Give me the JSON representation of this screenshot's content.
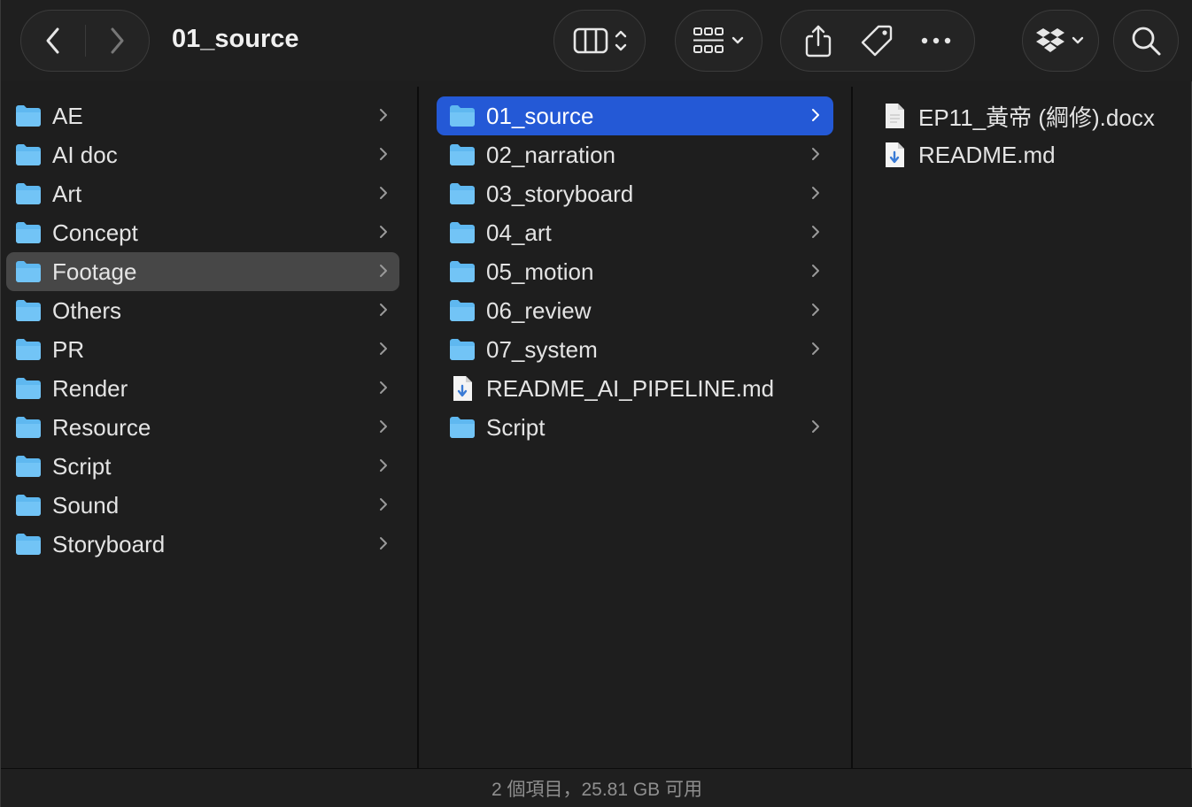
{
  "window": {
    "title": "01_source"
  },
  "toolbar": {
    "back_icon": "chevron-left-icon",
    "forward_icon": "chevron-right-icon",
    "view_icon": "columns-view-icon",
    "group_icon": "grid-group-icon",
    "share_icon": "share-icon",
    "tag_icon": "tag-icon",
    "more_icon": "ellipsis-icon",
    "dropbox_icon": "dropbox-icon",
    "search_icon": "search-icon"
  },
  "column1": {
    "items": [
      {
        "label": "AE",
        "type": "folder",
        "has_children": true
      },
      {
        "label": "AI doc",
        "type": "folder",
        "has_children": true
      },
      {
        "label": "Art",
        "type": "folder",
        "has_children": true
      },
      {
        "label": "Concept",
        "type": "folder",
        "has_children": true
      },
      {
        "label": "Footage",
        "type": "folder",
        "has_children": true,
        "selected": true
      },
      {
        "label": "Others",
        "type": "folder",
        "has_children": true
      },
      {
        "label": "PR",
        "type": "folder",
        "has_children": true
      },
      {
        "label": "Render",
        "type": "folder",
        "has_children": true
      },
      {
        "label": "Resource",
        "type": "folder",
        "has_children": true
      },
      {
        "label": "Script",
        "type": "folder",
        "has_children": true
      },
      {
        "label": "Sound",
        "type": "folder",
        "has_children": true
      },
      {
        "label": "Storyboard",
        "type": "folder",
        "has_children": true
      }
    ]
  },
  "column2": {
    "items": [
      {
        "label": "01_source",
        "type": "folder",
        "has_children": true,
        "selected": true
      },
      {
        "label": "02_narration",
        "type": "folder",
        "has_children": true
      },
      {
        "label": "03_storyboard",
        "type": "folder",
        "has_children": true
      },
      {
        "label": "04_art",
        "type": "folder",
        "has_children": true
      },
      {
        "label": "05_motion",
        "type": "folder",
        "has_children": true
      },
      {
        "label": "06_review",
        "type": "folder",
        "has_children": true
      },
      {
        "label": "07_system",
        "type": "folder",
        "has_children": true
      },
      {
        "label": "README_AI_PIPELINE.md",
        "type": "markdown",
        "has_children": false
      },
      {
        "label": "Script",
        "type": "folder",
        "has_children": true
      }
    ]
  },
  "column3": {
    "items": [
      {
        "label": "EP11_黃帝 (綱修).docx",
        "type": "docx"
      },
      {
        "label": "README.md",
        "type": "markdown"
      }
    ]
  },
  "status": {
    "text": "2 個項目，25.81 GB 可用"
  },
  "colors": {
    "accent": "#2459d6",
    "folder": "#5fb8f0",
    "background": "#1e1e1e"
  }
}
